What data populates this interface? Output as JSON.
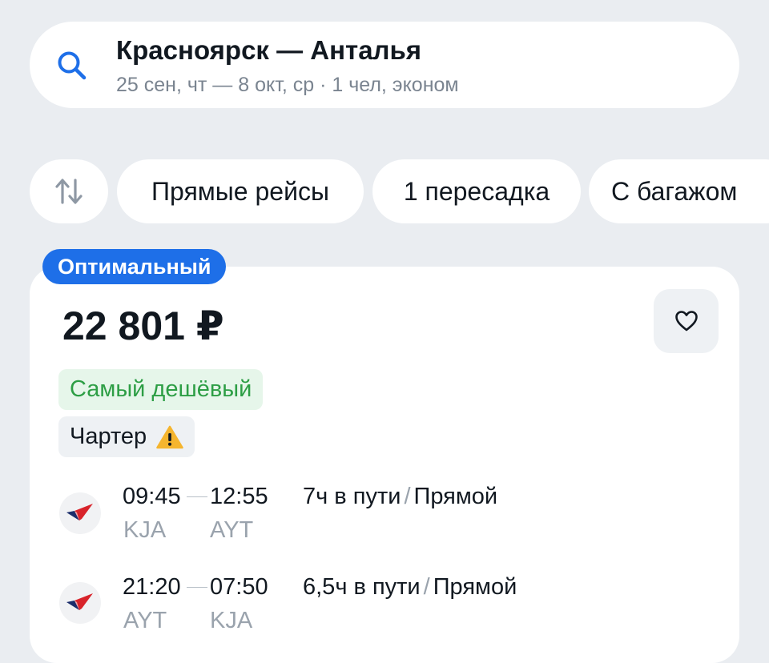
{
  "search": {
    "route": "Красноярск — Анталья",
    "details": "25 сен, чт — 8 окт, ср · 1 чел, эконом"
  },
  "filters": {
    "sort_icon": "sort-arrows-icon",
    "chips": [
      "Прямые рейсы",
      "1 пересадка",
      "С багажом"
    ]
  },
  "offer": {
    "badge": "Оптимальный",
    "price": "22 801 ₽",
    "tags": {
      "cheapest": "Самый дешёвый",
      "charter": "Чартер"
    },
    "segments": [
      {
        "depart_time": "09:45",
        "arrive_time": "12:55",
        "from": "KJA",
        "to": "AYT",
        "duration": "7ч в пути",
        "separator": "/",
        "type": "Прямой"
      },
      {
        "depart_time": "21:20",
        "arrive_time": "07:50",
        "from": "AYT",
        "to": "KJA",
        "duration": "6,5ч в пути",
        "separator": "/",
        "type": "Прямой"
      }
    ]
  },
  "colors": {
    "accent": "#1e6fe8",
    "success": "#2d9e45",
    "warning": "#f5b52e",
    "airline_red": "#d8232a",
    "airline_navy": "#1b2d6b"
  }
}
